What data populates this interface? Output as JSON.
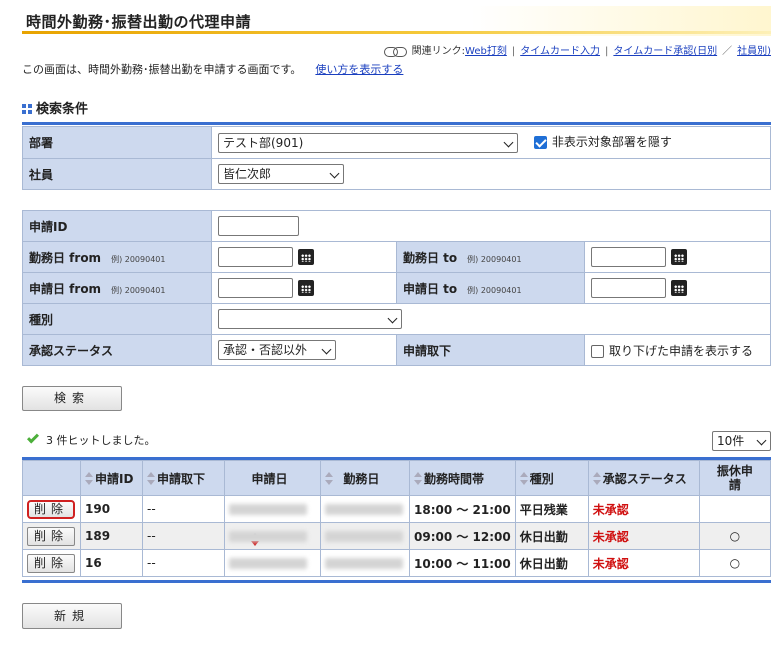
{
  "page": {
    "title": "時間外勤務･振替出勤の代理申請",
    "related_label": "関連リンク:",
    "related_links": [
      "Web打刻",
      "タイムカード入力",
      "タイムカード承認(日別",
      "社員別)"
    ],
    "description": "この画面は、時間外勤務･振替出勤を申請する画面です。",
    "howto_link": "使い方を表示する"
  },
  "search": {
    "heading": "検索条件",
    "dept_label": "部署",
    "dept_value": "テスト部(901)",
    "hide_dept_label": "非表示対象部署を隠す",
    "hide_dept_checked": true,
    "employee_label": "社員",
    "employee_value": "皆仁次郎",
    "app_id_label": "申請ID",
    "workday_from_label": "勤務日 from",
    "workday_to_label": "勤務日 to",
    "appdate_from_label": "申請日 from",
    "appdate_to_label": "申請日 to",
    "example": "例) 20090401",
    "type_label": "種別",
    "type_value": "",
    "approval_label": "承認ステータス",
    "approval_value": "承認・否認以外",
    "withdraw_label": "申請取下",
    "withdraw_check_label": "取り下げた申請を表示する",
    "withdraw_checked": false,
    "search_button": "検索"
  },
  "results": {
    "hit_text": "3 件ヒットしました。",
    "page_size": "10件",
    "columns": [
      "",
      "申請ID",
      "申請取下",
      "申請日",
      "勤務日",
      "勤務時間帯",
      "種別",
      "承認ステータス",
      "振休申請"
    ],
    "delete_label": "削除",
    "rows": [
      {
        "id": "190",
        "withdraw": "--",
        "time": "18:00 〜 21:00",
        "type": "平日残業",
        "status": "未承認",
        "furikyu": ""
      },
      {
        "id": "189",
        "withdraw": "--",
        "time": "09:00 〜 12:00",
        "type": "休日出勤",
        "status": "未承認",
        "furikyu": "○"
      },
      {
        "id": "16",
        "withdraw": "--",
        "time": "10:00 〜 11:00",
        "type": "休日出勤",
        "status": "未承認",
        "furikyu": "○"
      }
    ]
  },
  "new_button": "新規"
}
